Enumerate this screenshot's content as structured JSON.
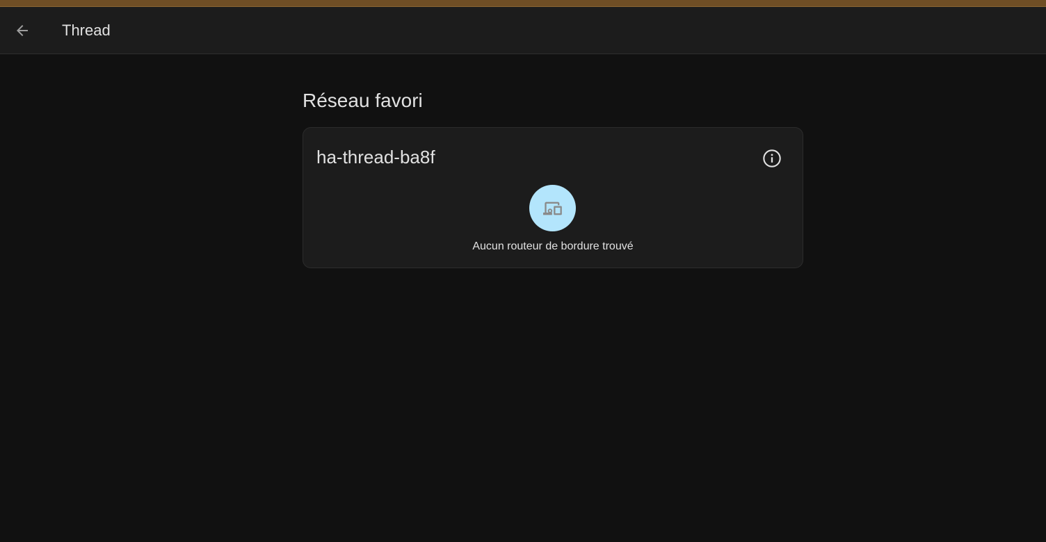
{
  "header": {
    "title": "Thread",
    "back_icon": "arrow-left-icon"
  },
  "main": {
    "section_title": "Réseau favori",
    "network_card": {
      "name": "ha-thread-ba8f",
      "info_icon": "info-circle-icon",
      "router_icon": "devices-icon",
      "empty_message": "Aucun routeur de bordure trouvé"
    }
  },
  "colors": {
    "accent_bar": "#6f4e25",
    "toolbar_bg": "#1c1c1c",
    "page_bg": "#111111",
    "card_bg": "#1c1c1c",
    "router_circle": "#b3e5fc"
  }
}
